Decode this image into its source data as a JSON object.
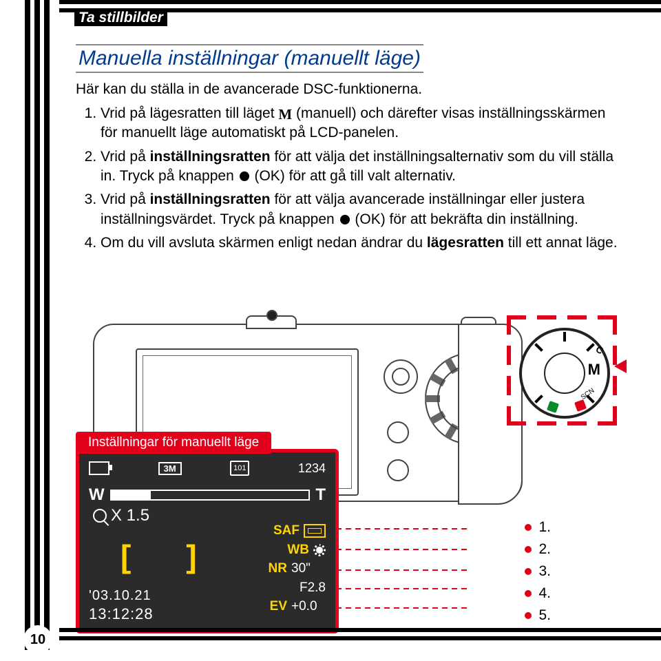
{
  "breadcrumb": "Ta stillbilder",
  "title": "Manuella inställningar (manuellt läge)",
  "intro": "Här kan du ställa in de avancerade DSC-funktionerna.",
  "steps": {
    "s1a": "Vrid på lägesratten till läget ",
    "s1_icon": "M",
    "s1b": " (manuell) och därefter visas inställningsskärmen för manuellt läge automatiskt på LCD-panelen.",
    "s2a": "Vrid på ",
    "s2_bold": "inställningsratten",
    "s2b": " för att välja det inställningsalternativ som du vill ställa in. Tryck på knappen ",
    "s2c": " (OK) för att gå till valt alternativ.",
    "s3a": "Vrid på ",
    "s3_bold": "inställningsratten",
    "s3b": " för att välja avancerade inställningar eller justera inställningsvärdet. Tryck på knappen ",
    "s3c": " (OK) för att bekräfta din inställning.",
    "s4a": "Om du vill avsluta skärmen enligt nedan ändrar du ",
    "s4_bold": "lägesratten",
    "s4b": " till ett annat läge."
  },
  "lcd": {
    "label": "Inställningar för manuellt läge",
    "three_m": "3M",
    "folder": "101",
    "counter": "1234",
    "W": "W",
    "T": "T",
    "zoom": "X 1.5",
    "date": "'03.10.21",
    "time": "13:12:28",
    "SAF": "SAF",
    "WB": "WB",
    "NR": "NR",
    "NR_val": "30\"",
    "F": "F2.8",
    "EV": "EV",
    "EV_val": "+0.0"
  },
  "modeDial": {
    "M": "M",
    "SCN": "SCN",
    "C": "C"
  },
  "callouts": {
    "c1": "1.",
    "c2": "2.",
    "c3": "3.",
    "c4": "4.",
    "c5": "5."
  },
  "pageNumber": "10"
}
